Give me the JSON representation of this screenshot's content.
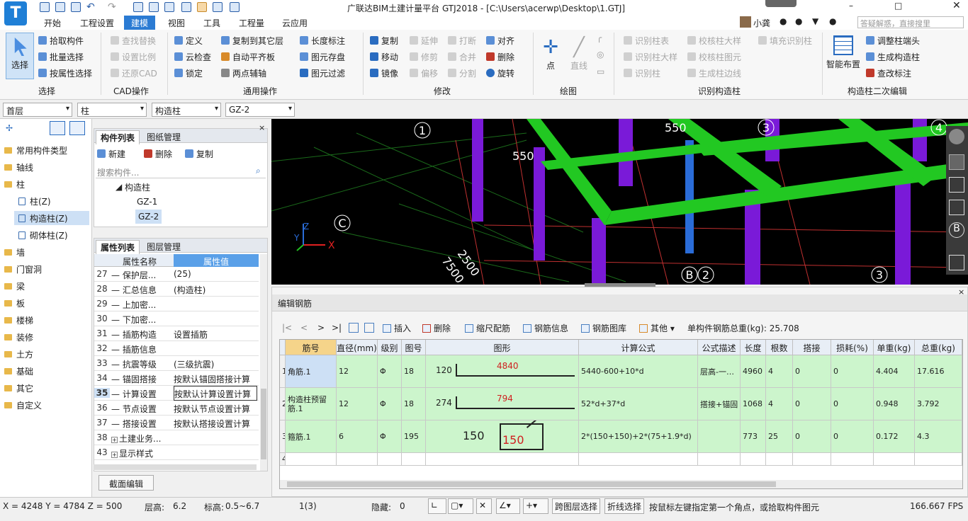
{
  "app": {
    "title": "广联达BIM土建计量平台 GTJ2018 - [C:\\Users\\acerwp\\Desktop\\1.GTJ]",
    "user": "小龚",
    "search_placeholder": "答疑解惑，直接搜里"
  },
  "menus": [
    "开始",
    "工程设置",
    "建模",
    "视图",
    "工具",
    "工程量",
    "云应用"
  ],
  "active_menu": "建模",
  "ribbon": {
    "select": {
      "big": "选择",
      "items": [
        "拾取构件",
        "批量选择",
        "按属性选择"
      ],
      "group": "选择"
    },
    "cad": {
      "items": [
        "查找替换",
        "设置比例",
        "还原CAD"
      ],
      "group": "CAD操作"
    },
    "general": {
      "col1": [
        "定义",
        "云检查",
        "锁定"
      ],
      "col2": [
        "复制到其它层",
        "自动平齐板",
        "两点辅轴"
      ],
      "col3": [
        "长度标注",
        "图元存盘",
        "图元过滤"
      ],
      "group": "通用操作"
    },
    "modify": {
      "col1": [
        "复制",
        "移动",
        "镜像"
      ],
      "col2": [
        "延伸",
        "修剪",
        "偏移"
      ],
      "col3": [
        "打断",
        "合并",
        "分割"
      ],
      "col4": [
        "对齐",
        "删除",
        "旋转"
      ],
      "group": "修改"
    },
    "draw": {
      "items": [
        "点",
        "直线"
      ],
      "group": "绘图"
    },
    "recognize": {
      "col1": [
        "识别柱表",
        "识别柱大样",
        "识别柱"
      ],
      "col2": [
        "校核柱大样",
        "校核柱图元",
        "生成柱边线"
      ],
      "col3": [
        "填充识别柱"
      ],
      "group": "识别构造柱"
    },
    "secondary": {
      "big": "智能布置",
      "items": [
        "调整柱端头",
        "生成构造柱",
        "查改标注"
      ],
      "group": "构造柱二次编辑"
    }
  },
  "selectors": [
    "首层",
    "柱",
    "构造柱",
    "GZ-2"
  ],
  "tree": {
    "items": [
      "常用构件类型",
      "轴线",
      "柱",
      "墙",
      "门窗洞",
      "梁",
      "板",
      "楼梯",
      "装修",
      "土方",
      "基础",
      "其它",
      "自定义"
    ],
    "sub": [
      "柱(Z)",
      "构造柱(Z)",
      "砌体柱(Z)"
    ]
  },
  "complist": {
    "tabs": [
      "构件列表",
      "图纸管理"
    ],
    "toolbar": [
      "新建",
      "删除",
      "复制"
    ],
    "search_placeholder": "搜索构件...",
    "category": "构造柱",
    "items": [
      "GZ-1",
      "GZ-2"
    ]
  },
  "proplist": {
    "tabs": [
      "属性列表",
      "图层管理"
    ],
    "headers": [
      "属性名称",
      "属性值"
    ],
    "rows": [
      {
        "n": "27",
        "k": "保护层...",
        "v": "(25)"
      },
      {
        "n": "28",
        "k": "汇总信息",
        "v": "(构造柱)"
      },
      {
        "n": "29",
        "k": "上加密...",
        "v": ""
      },
      {
        "n": "30",
        "k": "下加密...",
        "v": ""
      },
      {
        "n": "31",
        "k": "插筋构造",
        "v": "设置插筋"
      },
      {
        "n": "32",
        "k": "插筋信息",
        "v": ""
      },
      {
        "n": "33",
        "k": "抗震等级",
        "v": "(三级抗震)"
      },
      {
        "n": "34",
        "k": "锚固搭接",
        "v": "按默认锚固搭接计算"
      },
      {
        "n": "35",
        "k": "计算设置",
        "v": "按默认计算设置计算"
      },
      {
        "n": "36",
        "k": "节点设置",
        "v": "按默认节点设置计算"
      },
      {
        "n": "37",
        "k": "搭接设置",
        "v": "按默认搭接设置计算"
      },
      {
        "n": "38",
        "k": "土建业务...",
        "v": ""
      },
      {
        "n": "43",
        "k": "显示样式",
        "v": ""
      }
    ],
    "section_button": "截面编辑"
  },
  "view": {
    "labels": [
      "1",
      "3",
      "4",
      "C",
      "B",
      "2",
      "3"
    ],
    "dims": [
      "550",
      "550",
      "2500",
      "7500"
    ],
    "axes": [
      "X",
      "Y",
      "Z"
    ]
  },
  "rebar": {
    "title": "编辑钢筋",
    "toolbar": [
      "插入",
      "删除",
      "缩尺配筋",
      "钢筋信息",
      "钢筋图库",
      "其他"
    ],
    "total": "单构件钢筋总重(kg): 25.708",
    "headers": [
      "筋号",
      "直径(mm)",
      "级别",
      "图号",
      "图形",
      "计算公式",
      "公式描述",
      "长度",
      "根数",
      "搭接",
      "损耗(%)",
      "单重(kg)",
      "总重(kg)"
    ],
    "rows": [
      {
        "no": "1",
        "name": "角筋.1",
        "dia": "12",
        "grade": "Φ",
        "fig": "18",
        "s1": "120",
        "s2": "4840",
        "formula": "5440-600+10*d",
        "desc": "层高-一…",
        "len": "4960",
        "count": "4",
        "lap": "0",
        "loss": "0",
        "unit": "4.404",
        "total": "17.616"
      },
      {
        "no": "2",
        "name": "构造柱预留筋.1",
        "dia": "12",
        "grade": "Φ",
        "fig": "18",
        "s1": "274",
        "s2": "794",
        "formula": "52*d+37*d",
        "desc": "搭接+锚固",
        "len": "1068",
        "count": "4",
        "lap": "0",
        "loss": "0",
        "unit": "0.948",
        "total": "3.792"
      },
      {
        "no": "3",
        "name": "箍筋.1",
        "dia": "6",
        "grade": "Φ",
        "fig": "195",
        "s1": "150",
        "s2": "150",
        "formula": "2*(150+150)+2*(75+1.9*d)",
        "desc": "",
        "len": "773",
        "count": "25",
        "lap": "0",
        "loss": "0",
        "unit": "0.172",
        "total": "4.3"
      },
      {
        "no": "4",
        "name": "",
        "dia": "",
        "grade": "",
        "fig": "",
        "s1": "",
        "s2": "",
        "formula": "",
        "desc": "",
        "len": "",
        "count": "",
        "lap": "",
        "loss": "",
        "unit": "",
        "total": ""
      }
    ]
  },
  "status": {
    "coords": "X = 4248 Y = 4784 Z = 500",
    "floor_h_label": "层高:",
    "floor_h": "6.2",
    "elev_label": "标高:",
    "elev": "0.5~6.7",
    "count": "1(3)",
    "hide_label": "隐藏:",
    "hide": "0",
    "btn1": "跨图层选择",
    "btn2": "折线选择",
    "hint": "按鼠标左键指定第一个角点，或拾取构件图元",
    "fps": "166.667 FPS"
  }
}
